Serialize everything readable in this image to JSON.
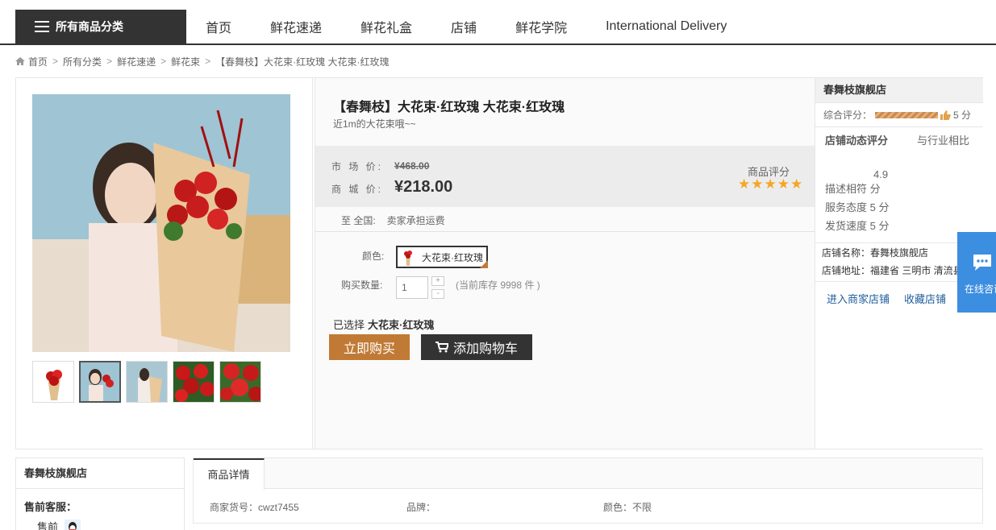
{
  "nav": {
    "all_categories": "所有商品分类",
    "links": [
      "首页",
      "鲜花速递",
      "鲜花礼盒",
      "店铺",
      "鲜花学院",
      "International Delivery"
    ]
  },
  "breadcrumb": [
    "首页",
    "所有分类",
    "鲜花速递",
    "鲜花束",
    "【春舞枝】大花束·红玫瑰 大花束·红玫瑰"
  ],
  "product": {
    "title": "【春舞枝】大花束·红玫瑰 大花束·红玫瑰",
    "subtitle": "近1m的大花束哦~~",
    "market_price_label": "市 场 价:",
    "market_price": "¥468.00",
    "shop_price_label": "商 城 价:",
    "shop_price": "¥218.00",
    "rating_label": "商品评分",
    "rating": 5,
    "ship_label": "至  全国:",
    "ship_value": "卖家承担运费",
    "color_label": "颜色:",
    "color_option": "大花束·红玫瑰",
    "qty_label": "购买数量:",
    "qty_value": "1",
    "stepper_plus": "+",
    "stepper_minus": "-",
    "stock": "(当前库存 9998 件 )",
    "chosen_label": "已选择",
    "chosen_value": "大花束·红玫瑰",
    "buy_now": "立即购买",
    "add_cart": "添加购物车",
    "thumb_count": 5,
    "active_thumb": 1
  },
  "store": {
    "name": "春舞枝旗舰店",
    "overall_label": "综合评分：",
    "overall_score": "5 分",
    "dynamic_title": "店铺动态评分",
    "compare_label": "与行业相比",
    "compare_value": "4.9",
    "desc_match": "描述相符 分",
    "service": "服务态度 5 分",
    "delivery": "发货速度 5 分",
    "store_name_line": "店铺名称：春舞枝旗舰店",
    "store_addr_line": "店铺地址：福建省 三明市 清流县",
    "enter_store": "进入商家店铺",
    "fav_store": "收藏店铺"
  },
  "online_service": "在线咨询",
  "shopbox": {
    "title": "春舞枝旗舰店",
    "presale_label": "售前客服：",
    "presale_item": "售前"
  },
  "detail": {
    "tab": "商品详情",
    "sku": "商家货号：cwzt7455",
    "brand": "品牌：",
    "color": "颜色：不限"
  }
}
